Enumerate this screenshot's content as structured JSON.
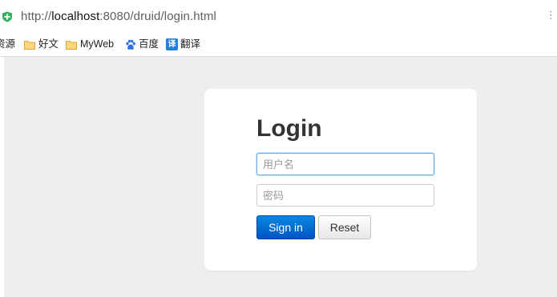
{
  "browser": {
    "url_prefix": "http://",
    "url_host": "localhost",
    "url_rest": ":8080/druid/login.html",
    "secure_icon": "green-plus-shield-icon",
    "more_icon": "kebab-menu-icon"
  },
  "bookmarks": [
    {
      "label": "资源",
      "icon": "cut-off-text"
    },
    {
      "label": "好文",
      "icon": "folder-icon"
    },
    {
      "label": "MyWeb",
      "icon": "folder-icon"
    },
    {
      "label": "百度",
      "icon": "baidu-paw-icon"
    },
    {
      "label": "翻译",
      "icon": "translate-icon",
      "icon_text": "译"
    }
  ],
  "login": {
    "title": "Login",
    "username_placeholder": "用户名",
    "password_placeholder": "密码",
    "signin_label": "Sign in",
    "reset_label": "Reset"
  },
  "colors": {
    "page_bg": "#eeeeee",
    "card_bg": "#ffffff",
    "primary_button": "#0a6fd8",
    "focus_border": "#66afe9"
  }
}
